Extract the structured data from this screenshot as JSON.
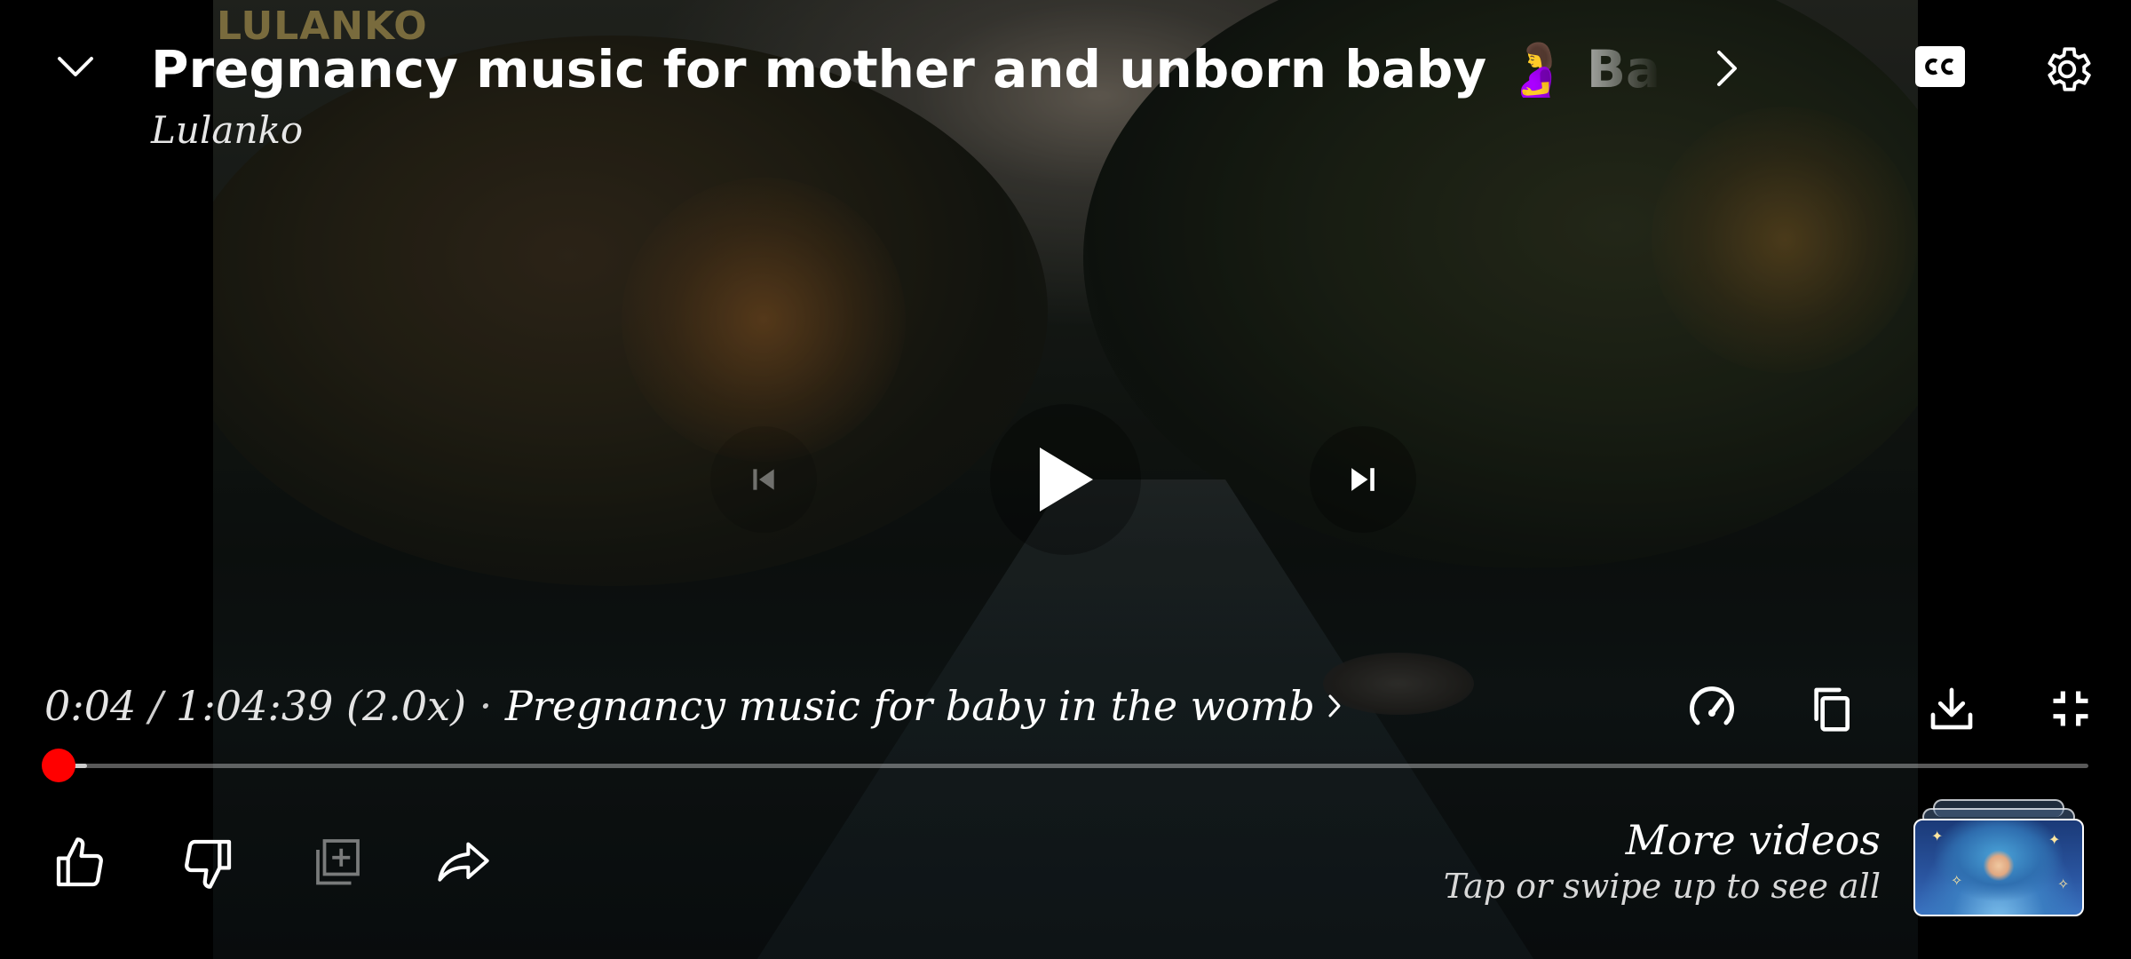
{
  "video": {
    "title": "Pregnancy music for mother and unborn baby 🤰 Baby brain development music",
    "channel": "Lulanko",
    "watermark": "LULANKO"
  },
  "playback": {
    "current_time": "0:04",
    "total_time": "1:04:39",
    "speed": "(2.0x)",
    "chapter_title": "Pregnancy music for baby in the womb",
    "progress_fraction": 0.00103,
    "buffered_fraction": 0.015,
    "state": "paused"
  },
  "controls": {
    "top": [
      "collapse",
      "cc",
      "settings"
    ],
    "center": [
      "previous",
      "play",
      "next"
    ],
    "right": [
      "playback-speed",
      "copy",
      "download",
      "exit-fullscreen"
    ],
    "actions": [
      "like",
      "dislike",
      "save-to-playlist",
      "share"
    ]
  },
  "more_videos": {
    "title": "More videos",
    "subtitle": "Tap or swipe up to see all"
  },
  "colors": {
    "accent_red": "#ff0000",
    "text_primary": "#ffffff",
    "background": "#000000"
  }
}
